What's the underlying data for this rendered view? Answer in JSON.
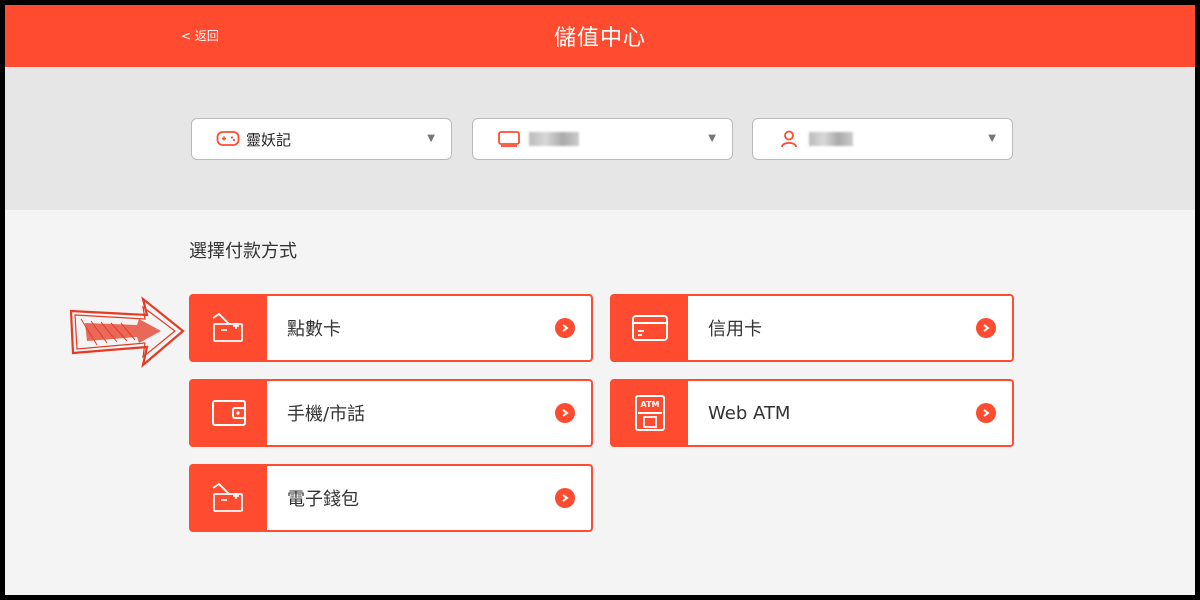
{
  "header": {
    "back_label": "< 返回",
    "title": "儲值中心"
  },
  "selectors": [
    {
      "icon": "gamepad-icon",
      "value": "靈妖記"
    },
    {
      "icon": "server-icon",
      "value": ""
    },
    {
      "icon": "user-icon",
      "value": ""
    }
  ],
  "payment": {
    "section_title": "選擇付款方式",
    "methods": [
      {
        "label": "點數卡",
        "icon": "point-card-icon"
      },
      {
        "label": "信用卡",
        "icon": "credit-card-icon"
      },
      {
        "label": "手機/市話",
        "icon": "wallet-icon"
      },
      {
        "label": "Web ATM",
        "icon": "atm-icon"
      },
      {
        "label": "電子錢包",
        "icon": "e-wallet-icon"
      }
    ]
  },
  "colors": {
    "accent": "#ff4b30",
    "band": "#e6e6e6",
    "background": "#f4f4f4"
  }
}
